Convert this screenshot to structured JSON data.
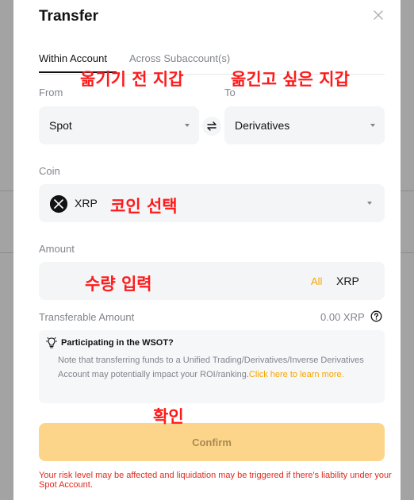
{
  "dialog": {
    "title": "Transfer"
  },
  "tabs": [
    {
      "label": "Within Account",
      "active": true
    },
    {
      "label": "Across Subaccount(s)",
      "active": false
    }
  ],
  "from": {
    "label": "From",
    "value": "Spot"
  },
  "to": {
    "label": "To",
    "value": "Derivatives"
  },
  "coin": {
    "label": "Coin",
    "value": "XRP"
  },
  "amount": {
    "label": "Amount",
    "all_label": "All",
    "unit": "XRP",
    "value": ""
  },
  "transferable": {
    "label": "Transferable Amount",
    "value": "0.00 XRP"
  },
  "notice": {
    "title": "Participating in the WSOT?",
    "text": "Note that transferring funds to a Unified Trading/Derivatives/Inverse Derivatives Account may potentially impact your ROI/ranking.",
    "link": "Click here to learn more."
  },
  "confirm_label": "Confirm",
  "risk_warning": "Your risk level may be affected and liquidation may be triggered if there's liability under your Spot Account.",
  "annotations": {
    "from_wallet": "옮기기 전 지갑",
    "to_wallet": "옮긴고 싶은 지갑",
    "coin_select": "코인 선택",
    "amount_input": "수량 입력",
    "confirm": "확인"
  },
  "colors": {
    "accent": "#f7a600",
    "confirm_bg": "#fdd58a",
    "warning": "#e0281d",
    "annotation": "#ff1a1a",
    "field_bg": "#f3f5f7"
  },
  "icons": {
    "close": "close-icon",
    "swap": "swap-arrows-icon",
    "coin": "xrp-coin-icon",
    "help": "help-circle-icon",
    "notice": "lightbulb-icon"
  }
}
